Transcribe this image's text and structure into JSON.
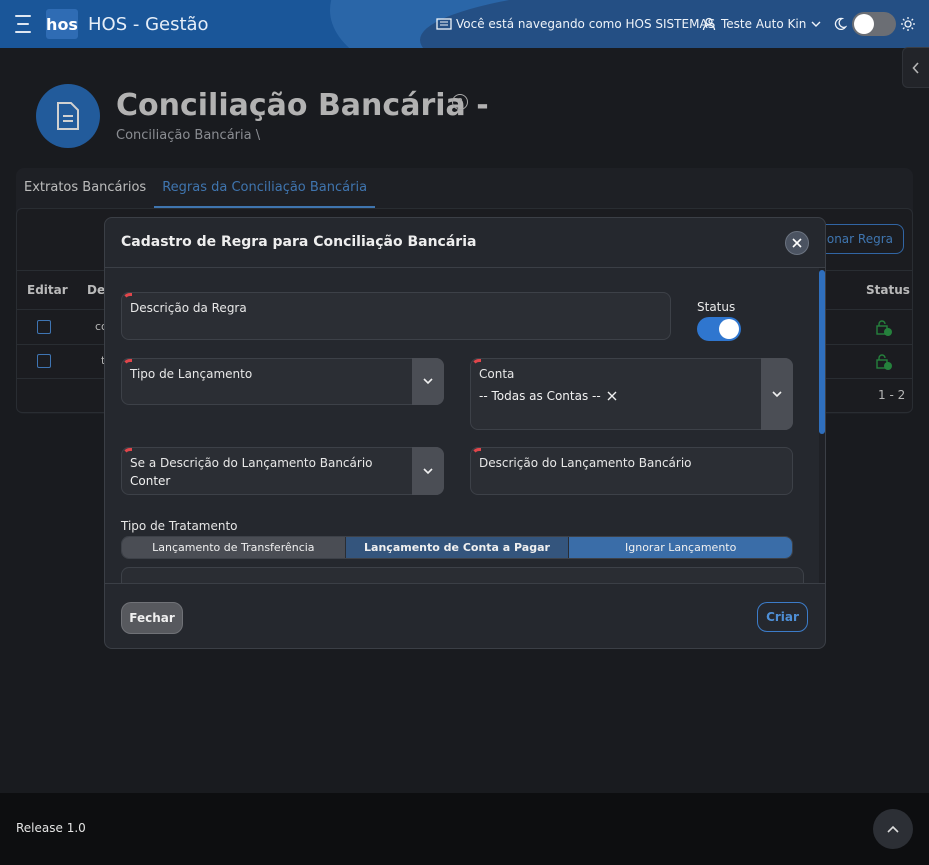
{
  "header": {
    "logo_text": "hos",
    "app_title": "HOS - Gestão",
    "navigating_as": "Você está navegando como HOS SISTEMAS",
    "user_name": "Teste Auto Kin"
  },
  "page": {
    "title": "Conciliação Bancária -",
    "breadcrumb": "Conciliação Bancária  \\"
  },
  "tabs": [
    {
      "label": "Extratos Bancários"
    },
    {
      "label": "Regras da Conciliação Bancária"
    }
  ],
  "table": {
    "add_button": "cionar Regra",
    "headers": {
      "edit": "Editar",
      "desc": "Des",
      "status": "Status"
    },
    "rows": [
      {
        "text": "co"
      },
      {
        "text": "t"
      }
    ],
    "pagination": "1 - 2"
  },
  "modal": {
    "title": "Cadastro de Regra para Conciliação Bancária",
    "descricao_regra_label": "Descrição da Regra",
    "status_label": "Status",
    "status_on": true,
    "tipo_lancamento_label": "Tipo de Lançamento",
    "conta_label": "Conta",
    "conta_value": "-- Todas as Contas --",
    "se_descricao_label": "Se a Descrição do Lançamento Bancário",
    "se_descricao_value": "Conter",
    "descricao_lancamento_label": "Descrição do Lançamento Bancário",
    "tipo_tratamento_label": "Tipo de Tratamento",
    "tratamento_options": [
      "Lançamento de Transferência",
      "Lançamento de Conta a Pagar",
      "Ignorar Lançamento"
    ],
    "fechar_label": "Fechar",
    "criar_label": "Criar"
  },
  "footer": {
    "release": "Release 1.0"
  },
  "colors": {
    "accent": "#2f76cf",
    "required": "#e0464b",
    "topbar": "#1a5699"
  }
}
